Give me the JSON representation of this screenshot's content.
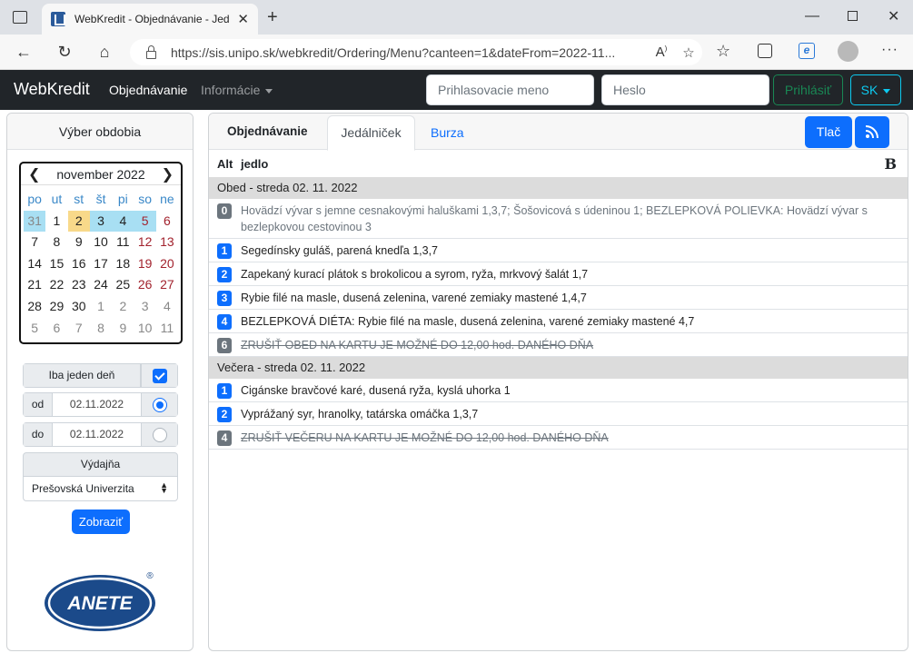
{
  "browser": {
    "tab_title": "WebKredit - Objednávanie - Jeda",
    "url": "https://sis.unipo.sk/webkredit/Ordering/Menu?canteen=1&dateFrom=2022-11..."
  },
  "navbar": {
    "brand": "WebKredit",
    "order": "Objednávanie",
    "info": "Informácie",
    "login_placeholder": "Prihlasovacie meno",
    "password_placeholder": "Heslo",
    "login_button": "Prihlásiť",
    "lang": "SK"
  },
  "left": {
    "title": "Výber obdobia",
    "calendar": {
      "month": "november 2022",
      "days_header": [
        "po",
        "ut",
        "st",
        "št",
        "pi",
        "so",
        "ne"
      ],
      "weeks": [
        [
          "31",
          "1",
          "2",
          "3",
          "4",
          "5",
          "6"
        ],
        [
          "7",
          "8",
          "9",
          "10",
          "11",
          "12",
          "13"
        ],
        [
          "14",
          "15",
          "16",
          "17",
          "18",
          "19",
          "20"
        ],
        [
          "21",
          "22",
          "23",
          "24",
          "25",
          "26",
          "27"
        ],
        [
          "28",
          "29",
          "30",
          "1",
          "2",
          "3",
          "4"
        ],
        [
          "5",
          "6",
          "7",
          "8",
          "9",
          "10",
          "11"
        ]
      ]
    },
    "only_one_day": "Iba jeden deň",
    "from_label": "od",
    "from_value": "02.11.2022",
    "to_label": "do",
    "to_value": "02.11.2022",
    "outlet_label": "Výdajňa",
    "outlet_value": "Prešovská Univerzita",
    "show_button": "Zobraziť",
    "logo_text": "ANETE"
  },
  "right": {
    "tabs": [
      "Objednávanie",
      "Jedálniček",
      "Burza"
    ],
    "print_button": "Tlač",
    "col_alt": "Alt",
    "col_food": "jedlo",
    "col_b": "B",
    "sections": [
      {
        "title": "Obed - streda 02. 11. 2022",
        "items": [
          {
            "alt": "0",
            "text": "Hovädzí vývar s jemne cesnakovými haluškami 1,3,7; Šošovicová s údeninou 1; BEZLEPKOVÁ POLIEVKA: Hovädzí vývar s bezlepkovou cestovinou 3"
          },
          {
            "alt": "1",
            "text": "Segedínsky guláš, parená knedľa 1,3,7"
          },
          {
            "alt": "2",
            "text": "Zapekaný kurací plátok s brokolicou a syrom, ryža, mrkvový šalát 1,7"
          },
          {
            "alt": "3",
            "text": "Rybie filé na masle, dusená zelenina, varené zemiaky mastené 1,4,7"
          },
          {
            "alt": "4",
            "text": "BEZLEPKOVÁ DIÉTA: Rybie filé na masle, dusená zelenina, varené zemiaky mastené 4,7"
          },
          {
            "alt": "6",
            "text": "ZRUŠIŤ OBED NA KARTU JE MOŽNÉ DO 12,00 hod. DANÉHO DŇA"
          }
        ]
      },
      {
        "title": "Večera - streda 02. 11. 2022",
        "items": [
          {
            "alt": "1",
            "text": "Cigánske bravčové karé, dusená ryža, kyslá uhorka 1"
          },
          {
            "alt": "2",
            "text": "Vyprážaný syr, hranolky, tatárska omáčka 1,3,7"
          },
          {
            "alt": "4",
            "text": "ZRUŠIŤ VEČERU NA KARTU JE MOŽNÉ DO 12,00 hod. DANÉHO DŇA"
          }
        ]
      }
    ]
  }
}
